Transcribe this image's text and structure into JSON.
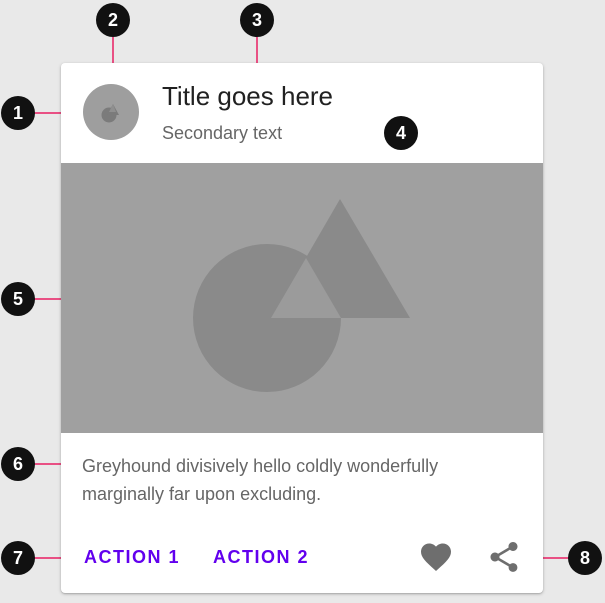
{
  "card": {
    "title": "Title goes here",
    "secondary_text": "Secondary text",
    "supporting_text": "Greyhound divisively hello coldly wonderfully marginally far upon excluding.",
    "action_1": "ACTION 1",
    "action_2": "ACTION 2",
    "icons": {
      "avatar": "shapes-thumbnail-icon",
      "media": "shapes-placeholder-image",
      "favorite": "heart-icon",
      "share": "share-icon"
    }
  },
  "markers": {
    "m1": "1",
    "m2": "2",
    "m3": "3",
    "m4": "4",
    "m5": "5",
    "m6": "6",
    "m7": "7",
    "m8": "8"
  },
  "colors": {
    "background": "#e9e9e9",
    "card": "#ffffff",
    "action_text": "#6200ee",
    "callout_line": "#e91e63",
    "marker": "#111111",
    "placeholder": "#a0a0a0",
    "placeholder_shape": "#8a8a8a"
  }
}
